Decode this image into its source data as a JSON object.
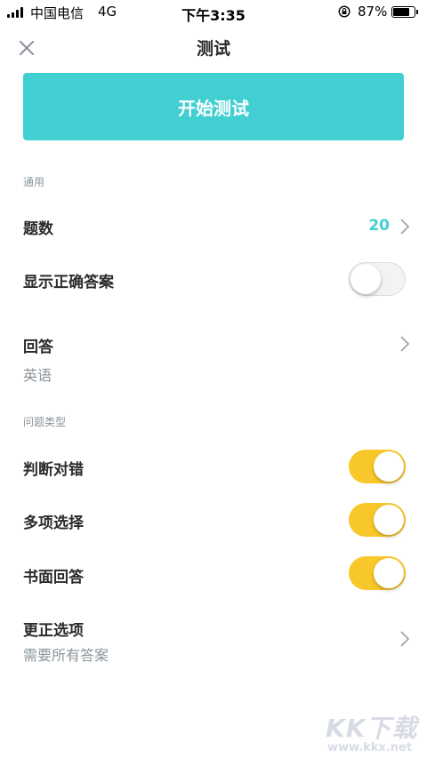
{
  "status_bar": {
    "carrier": "中国电信",
    "network": "4G",
    "time": "下午3:35",
    "battery_percent": "87%",
    "battery_level": 0.87
  },
  "nav": {
    "title": "测试",
    "close_icon": "close-icon"
  },
  "start_button": {
    "label": "开始测试"
  },
  "sections": {
    "general_header": "通用",
    "question_types_header": "问题类型"
  },
  "rows": {
    "question_count": {
      "label": "题数",
      "value": "20"
    },
    "show_correct_answer": {
      "label": "显示正确答案",
      "enabled": false
    },
    "answer": {
      "label": "回答",
      "value": "英语"
    },
    "true_false": {
      "label": "判断对错",
      "enabled": true
    },
    "multiple_choice": {
      "label": "多项选择",
      "enabled": true
    },
    "written": {
      "label": "书面回答",
      "enabled": true
    },
    "correction_options": {
      "label": "更正选项",
      "value": "需要所有答案"
    }
  },
  "watermark": {
    "logo_text": "KK下载",
    "url": "www.kkx.net"
  },
  "colors": {
    "accent_teal": "#41cfd1",
    "toggle_on": "#f8c82a",
    "secondary_text": "#8a949b"
  }
}
